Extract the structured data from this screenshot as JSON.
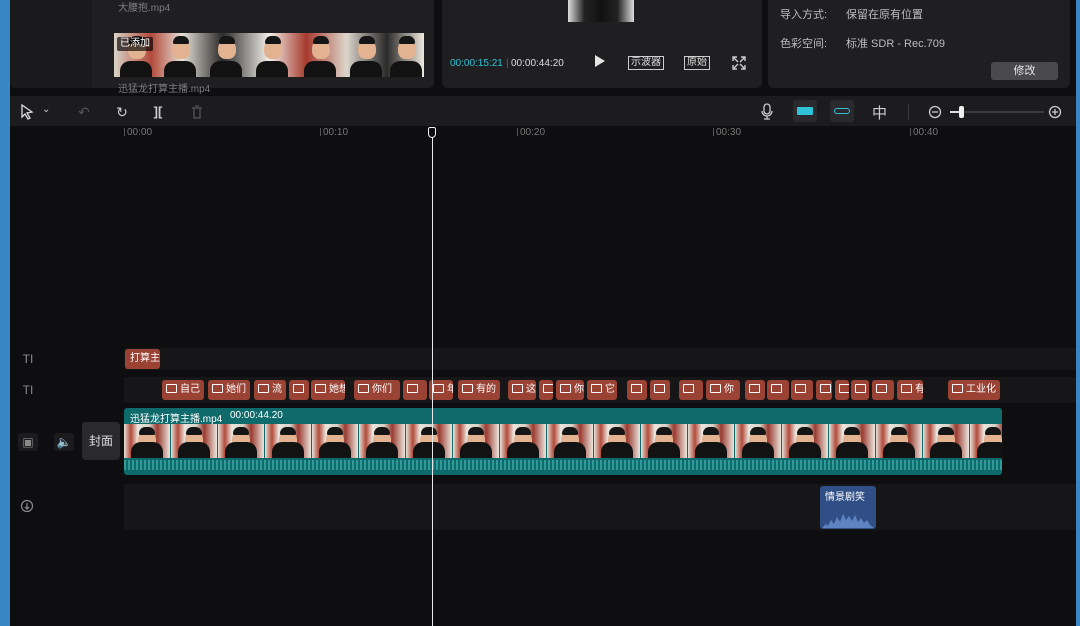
{
  "media_panel": {
    "file1_name": "大腰抱.mp4",
    "added_badge": "已添加",
    "file2_name": "迅猛龙打算主播.mp4"
  },
  "player": {
    "current_time": "00:00:15:21",
    "separator": "|",
    "total_time": "00:00:44:20",
    "scope_button": "示波器",
    "original_button": "原始"
  },
  "properties": {
    "import_label": "导入方式:",
    "import_value": "保留在原有位置",
    "color_label": "色彩空间:",
    "color_value": "标准 SDR - Rec.709",
    "modify_button": "修改"
  },
  "ruler": {
    "ticks": [
      "00:00",
      "00:10",
      "00:20",
      "00:30",
      "00:40"
    ]
  },
  "tracks": {
    "text_chip_first": "打算主",
    "subtitle_chips": [
      "自己",
      "她们",
      "流",
      "",
      "她想",
      "你",
      "你们",
      "",
      "年",
      "有的",
      "这",
      "",
      "你",
      "它",
      "",
      "",
      "",
      "你",
      "",
      "",
      "",
      "",
      "打",
      "",
      "有",
      "",
      "工业化"
    ],
    "cover_label": "封面",
    "video_clip_name": "迅猛龙打算主播.mp4",
    "video_clip_duration": "00:00:44.20",
    "audio_clip_name": "情景剧笑"
  },
  "colors": {
    "accent_cyan": "#2fc2d6",
    "clip_teal": "#0f6b6b",
    "chip_red": "#9a4234",
    "audio_blue": "#2f4f86"
  }
}
